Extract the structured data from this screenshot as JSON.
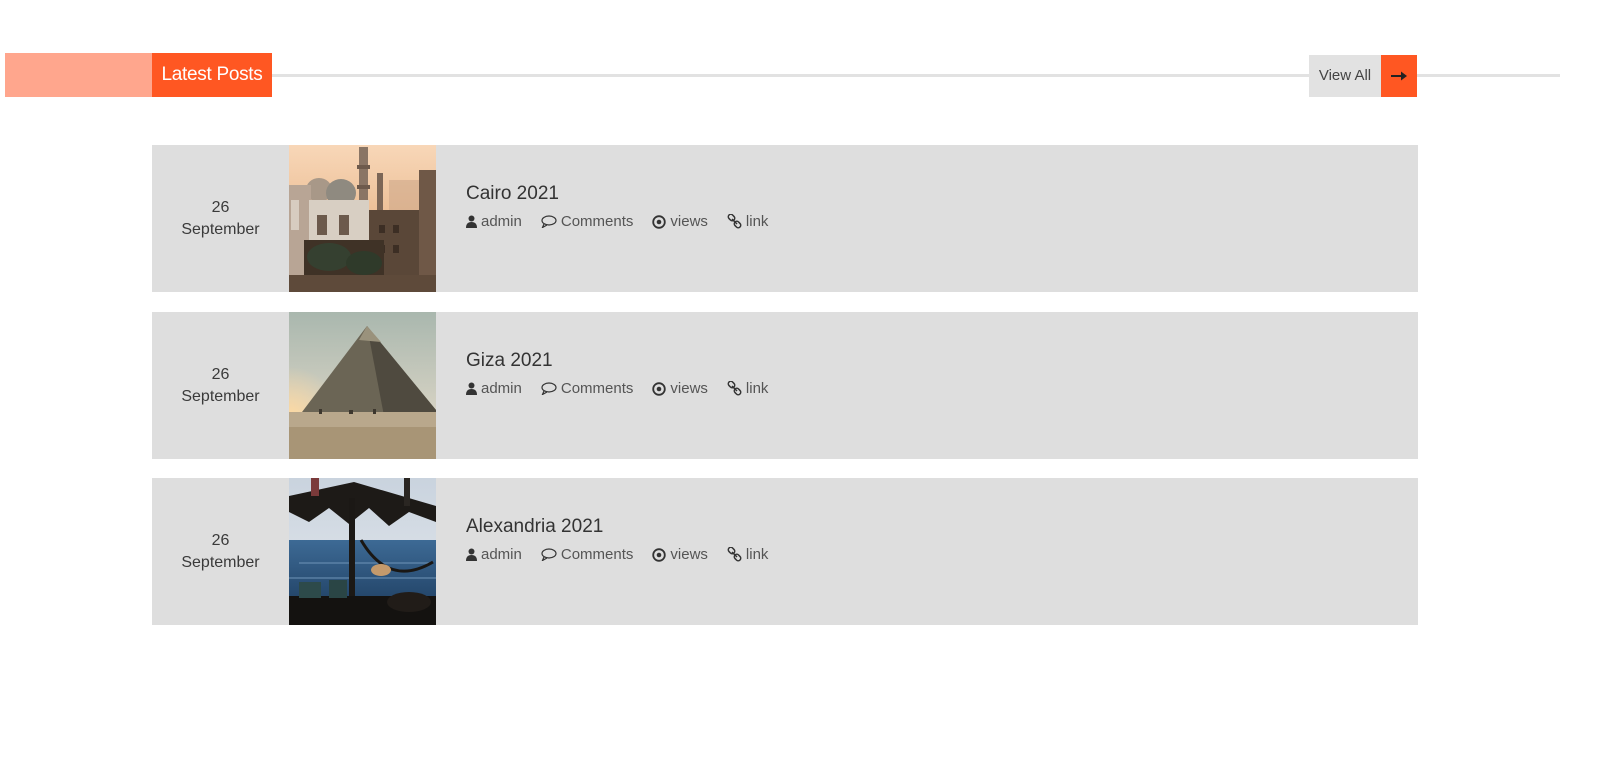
{
  "section": {
    "title": "Latest Posts",
    "view_all_label": "View All",
    "accent_color": "#ff5722",
    "accent_light_color": "#ffa68d"
  },
  "posts": [
    {
      "day": "26",
      "month": "September",
      "title": "Cairo 2021",
      "thumbnail": "cairo-mosque-photo",
      "meta": {
        "author": "admin",
        "comments": "Comments",
        "views": "views",
        "link": "link"
      }
    },
    {
      "day": "26",
      "month": "September",
      "title": "Giza 2021",
      "thumbnail": "giza-pyramid-photo",
      "meta": {
        "author": "admin",
        "comments": "Comments",
        "views": "views",
        "link": "link"
      }
    },
    {
      "day": "26",
      "month": "September",
      "title": "Alexandria 2021",
      "thumbnail": "alexandria-beach-photo",
      "meta": {
        "author": "admin",
        "comments": "Comments",
        "views": "views",
        "link": "link"
      }
    }
  ],
  "icons": {
    "author": "user-icon",
    "comments": "comment-bubble-icon",
    "views": "eye-dot-icon",
    "link": "link-chain-icon",
    "view_all": "arrow-right-icon"
  }
}
